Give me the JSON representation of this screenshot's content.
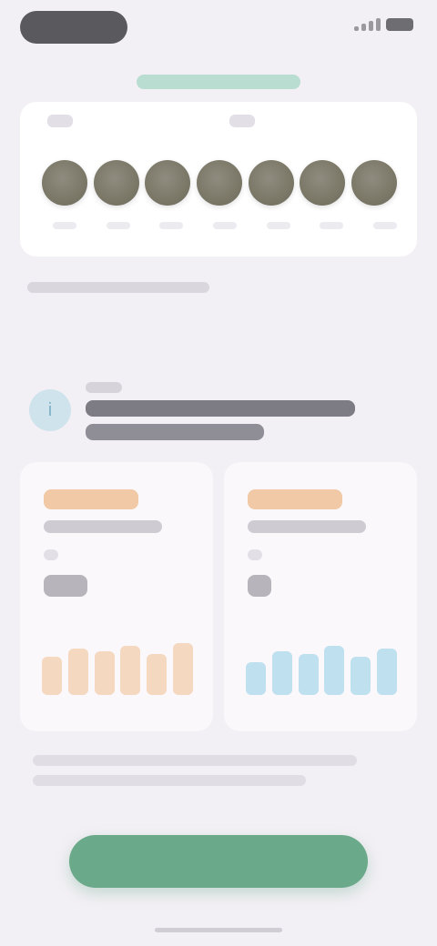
{
  "status_bar": {
    "time": "",
    "colors": {
      "pill": "#5a5a5e",
      "battery": "#6e6e72"
    }
  },
  "header": {
    "link_text": ""
  },
  "calendar": {
    "labels": [
      "",
      ""
    ],
    "days": [
      {
        "icon": "food-photo-icon"
      },
      {
        "icon": "food-photo-icon"
      },
      {
        "icon": "food-photo-icon"
      },
      {
        "icon": "food-photo-icon"
      },
      {
        "icon": "food-photo-icon"
      },
      {
        "icon": "food-photo-icon"
      },
      {
        "icon": "food-photo-icon"
      }
    ]
  },
  "caption": "",
  "section": {
    "icon": "info-circle-icon",
    "kicker": "",
    "title": ""
  },
  "metrics": [
    {
      "tag": "",
      "subtitle": "",
      "value": "",
      "accent": "#f2c9a6",
      "bar_color": "#f5d8c0",
      "bars": [
        0.7,
        0.85,
        0.8,
        0.9,
        0.75,
        0.95
      ]
    },
    {
      "tag": "",
      "subtitle": "",
      "value": "",
      "accent": "#f2c9a6",
      "bar_color": "#bfe0ef",
      "bars": [
        0.6,
        0.8,
        0.75,
        0.9,
        0.7,
        0.85
      ]
    }
  ],
  "footnote": "",
  "cta": {
    "label": "",
    "color": "#6aa98a"
  }
}
